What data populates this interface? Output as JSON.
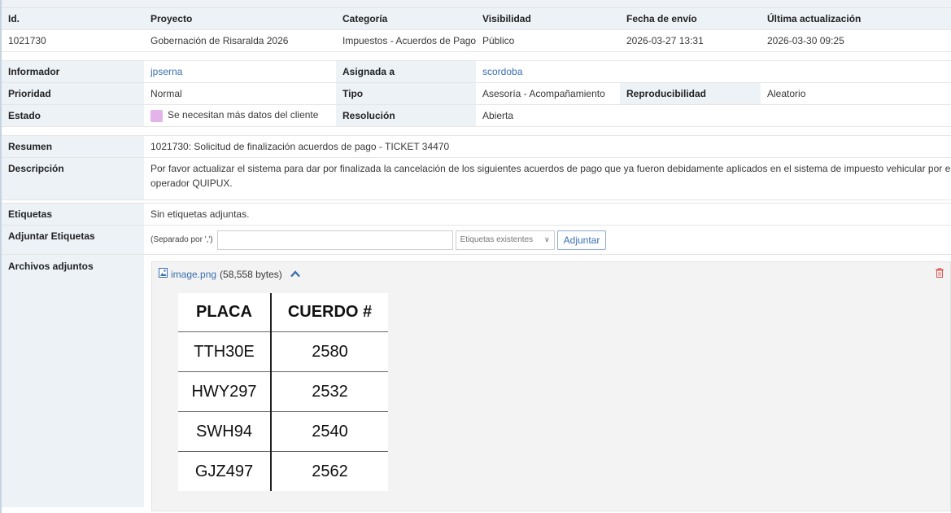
{
  "summary_header": {
    "columns": [
      "Id.",
      "Proyecto",
      "Categoría",
      "Visibilidad",
      "Fecha de envío",
      "Última actualización"
    ],
    "values": [
      "1021730",
      "Gobernación de Risaralda 2026",
      "Impuestos - Acuerdos de Pago",
      "Público",
      "2026-03-27 13:31",
      "2026-03-30 09:25"
    ]
  },
  "details": {
    "informador_label": "Informador",
    "informador_value": "jpserna",
    "asignada_label": "Asignada a",
    "asignada_value": "scordoba",
    "prioridad_label": "Prioridad",
    "prioridad_value": "Normal",
    "tipo_label": "Tipo",
    "tipo_value": "Asesoría - Acompañamiento",
    "reproducibilidad_label": "Reproducibilidad",
    "reproducibilidad_value": "Aleatorio",
    "estado_label": "Estado",
    "estado_value": "Se necesitan más datos del cliente",
    "estado_color": "#e2b4ea",
    "resolucion_label": "Resolución",
    "resolucion_value": "Abierta"
  },
  "body": {
    "resumen_label": "Resumen",
    "resumen_value": "1021730: Solicitud de finalización acuerdos de pago - TICKET 34470",
    "descripcion_label": "Descripción",
    "descripcion_line1": "Por favor actualizar el sistema para dar por finalizada la cancelación de los siguientes acuerdos de pago que ya fueron debidamente aplicados en el sistema de impuesto vehicular por el",
    "descripcion_line2": "operador QUIPUX.",
    "etiquetas_label": "Etiquetas",
    "etiquetas_value": "Sin etiquetas adjuntas.",
    "adjuntar_label": "Adjuntar Etiquetas",
    "adjuntar_hint": "(Separado por ',')",
    "adjuntar_input_value": "",
    "etiquetas_select": "Etiquetas existentes",
    "adjuntar_button": "Adjuntar",
    "archivos_label": "Archivos adjuntos"
  },
  "attachment": {
    "file_icon": "image-file-icon",
    "file_name": "image.png",
    "file_size": "(58,558 bytes)",
    "collapse_icon": "chevron-up-icon",
    "delete_icon": "trash-icon",
    "preview_table": {
      "headers": [
        "PLACA",
        "CUERDO #"
      ],
      "rows": [
        [
          "TTH30E",
          "2580"
        ],
        [
          "HWY297",
          "2532"
        ],
        [
          "SWH94",
          "2540"
        ],
        [
          "GJZ497",
          "2562"
        ]
      ]
    }
  },
  "colors": {
    "label_bg": "#edf2f7",
    "link": "#3a6fb0",
    "delete": "#d9534f"
  }
}
